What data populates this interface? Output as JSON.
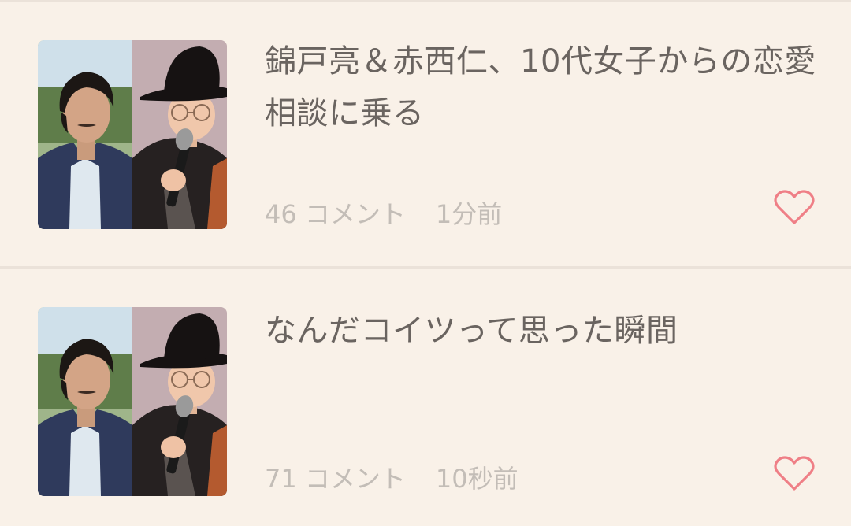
{
  "articles": [
    {
      "title": "錦戸亮＆赤西仁、10代女子からの恋愛相談に乗る",
      "comments": "46 コメント",
      "time": "1分前",
      "thumbnail_icon": "two-men-photo"
    },
    {
      "title": "なんだコイツって思った瞬間",
      "comments": "71 コメント",
      "time": "10秒前",
      "thumbnail_icon": "two-men-photo"
    }
  ],
  "colors": {
    "background": "#f9f1e8",
    "title": "#6a6460",
    "meta": "#c3bdb7",
    "heart": "#ef7f86",
    "divider": "#ebe2d9"
  }
}
